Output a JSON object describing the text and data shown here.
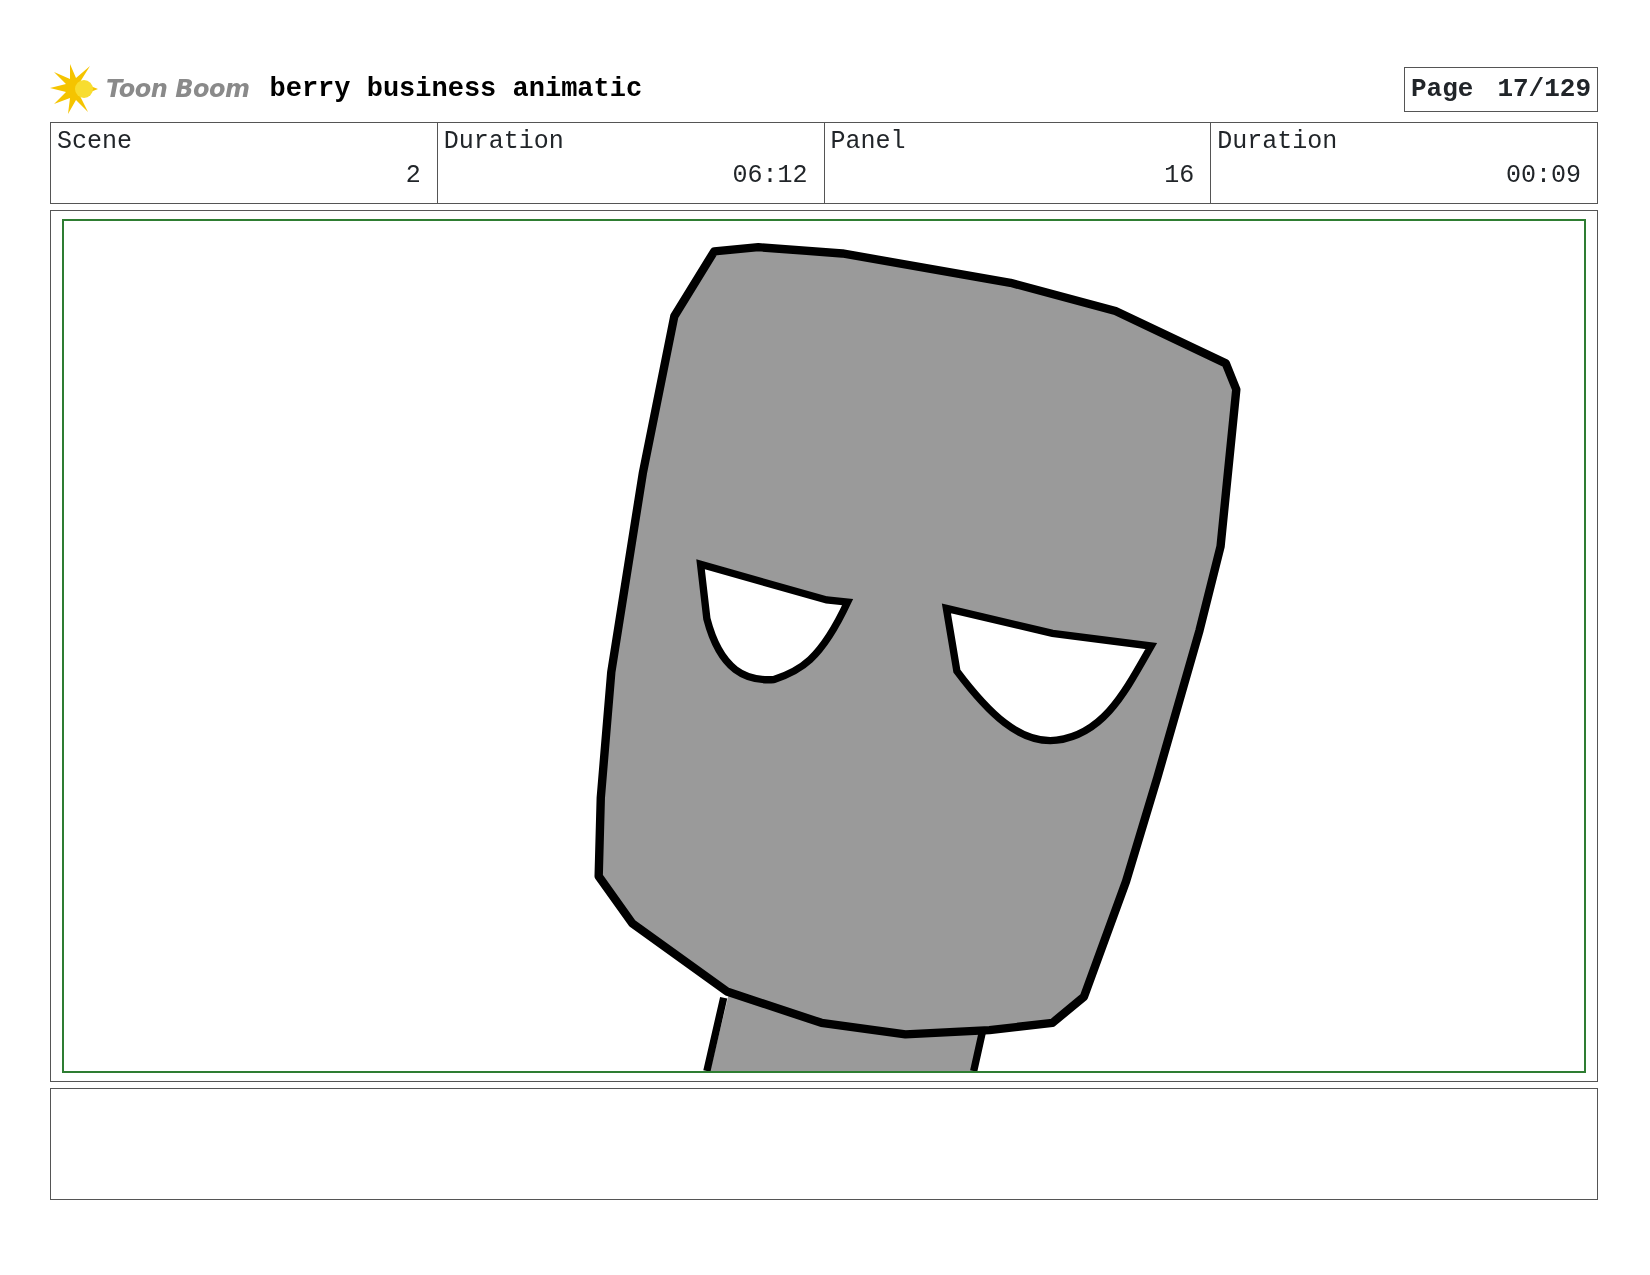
{
  "header": {
    "logo_text": "Toon Boom",
    "title": "berry business animatic",
    "page_label": "Page",
    "page_number": "17/129"
  },
  "info": [
    {
      "label": "Scene",
      "value": "2"
    },
    {
      "label": "Duration",
      "value": "06:12"
    },
    {
      "label": "Panel",
      "value": "16"
    },
    {
      "label": "Duration",
      "value": "00:09"
    }
  ]
}
